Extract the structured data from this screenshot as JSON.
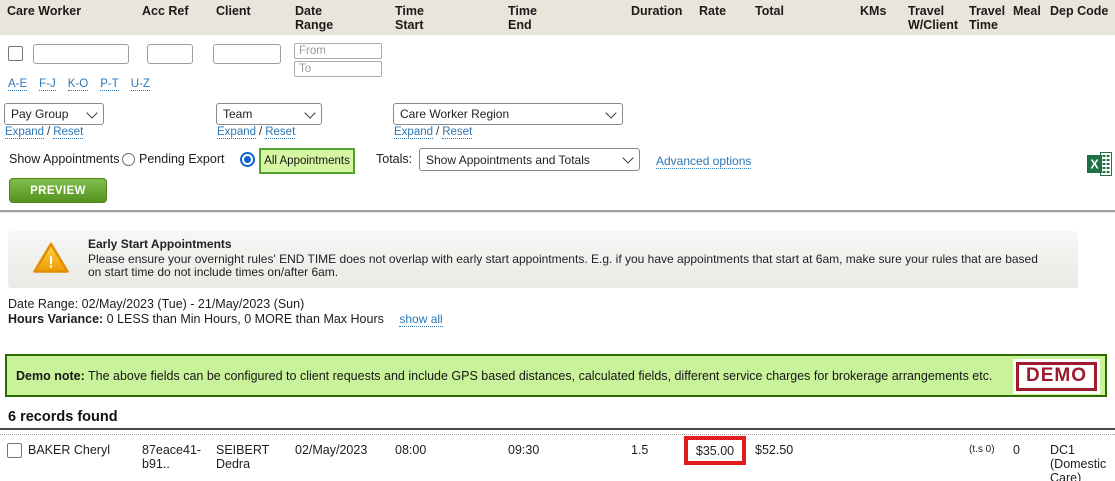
{
  "columns": {
    "care_worker": "Care Worker",
    "acc_ref": "Acc Ref",
    "client": "Client",
    "date_range": {
      "l1": "Date",
      "l2": "Range"
    },
    "time_start": {
      "l1": "Time",
      "l2": "Start"
    },
    "time_end": {
      "l1": "Time",
      "l2": "End"
    },
    "duration": "Duration",
    "rate": "Rate",
    "total": "Total",
    "kms": "KMs",
    "travel_wclient": {
      "l1": "Travel",
      "l2": "W/Client"
    },
    "travel_time": {
      "l1": "Travel",
      "l2": "Time"
    },
    "meal": "Meal",
    "dep_code": "Dep Code"
  },
  "filters": {
    "date_from_placeholder": "From",
    "date_to_placeholder": "To",
    "alpha_links": [
      "A-E",
      "F-J",
      "K-O",
      "P-T",
      "U-Z"
    ],
    "pay_group": "Pay Group",
    "team": "Team",
    "care_worker_region": "Care Worker Region",
    "expand": "Expand",
    "slash": "/",
    "reset": "Reset",
    "show_appointments_label": "Show Appointments",
    "pending_export_label": "Pending Export",
    "all_appointments_label": "All Appointments",
    "totals_label": "Totals:",
    "totals_value": "Show Appointments and Totals",
    "advanced_options": "Advanced options",
    "preview_button": "PREVIEW"
  },
  "icons": {
    "excel_export": "excel-export-icon",
    "warning": "warning-triangle-icon"
  },
  "warning": {
    "title": "Early Start Appointments",
    "body": "Please ensure your overnight rules' END TIME does not overlap with early start appointments. E.g. if you have appointments that start at 6am, make sure your rules that are based on start time do not include times on/after 6am."
  },
  "summary": {
    "date_range_label": "Date Range:",
    "date_range_value": "02/May/2023 (Tue) - 21/May/2023 (Sun)",
    "hours_variance_label": "Hours Variance:",
    "hours_variance_value": "0 LESS than Min Hours, 0 MORE than Max Hours",
    "show_all_link": "show all"
  },
  "demo_note": {
    "label": "Demo note:",
    "text": " The above fields can be configured to client requests and include GPS based distances, calculated fields, different service charges for brokerage arrangements etc.",
    "badge": "DEMO"
  },
  "results": {
    "count_text": "6 records found",
    "row": {
      "care_worker": "BAKER Cheryl",
      "acc_ref": {
        "l1": "87eace41-",
        "l2": "b91.."
      },
      "client": {
        "l1": "SEIBERT",
        "l2": "Dedra"
      },
      "date": "02/May/2023",
      "time_start": "08:00",
      "time_end": "09:30",
      "duration": "1.5",
      "rate": "$35.00",
      "total": "$52.50",
      "travel_time_note": "(t.s 0)",
      "meal": "0",
      "dep_code": {
        "l1": "DC1",
        "l2": "(Domestic",
        "l3": "Care)"
      }
    }
  },
  "colors": {
    "header_bg": "#e9e5da",
    "link_blue": "#2d77b5",
    "preview_green": "#55931f",
    "highlight_green_bg": "#d5f7a2",
    "highlight_green_border": "#54a033",
    "demo_bg": "#c9f39b",
    "demo_border": "#2f6c00",
    "demo_red": "#9c1c2c",
    "rate_highlight_red": "#e21d1d",
    "excel_green": "#1e7145",
    "radio_blue": "#0f62cf"
  }
}
